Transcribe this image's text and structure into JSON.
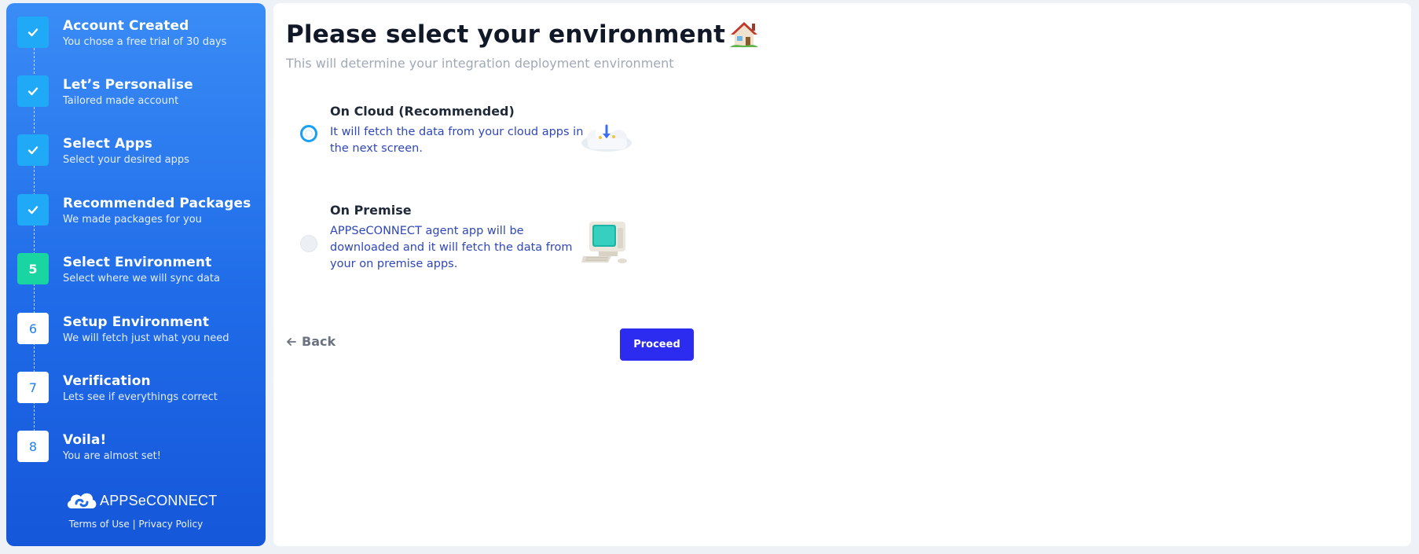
{
  "sidebar": {
    "steps": [
      {
        "badge": "",
        "title": "Account Created",
        "subtitle": "You chose a free trial of 30 days",
        "status": "done"
      },
      {
        "badge": "",
        "title": "Let’s Personalise",
        "subtitle": "Tailored made account",
        "status": "done"
      },
      {
        "badge": "",
        "title": "Select Apps",
        "subtitle": "Select your desired apps",
        "status": "done"
      },
      {
        "badge": "",
        "title": "Recommended Packages",
        "subtitle": "We made packages for you",
        "status": "done"
      },
      {
        "badge": "5",
        "title": "Select Environment",
        "subtitle": "Select where we will sync data",
        "status": "active"
      },
      {
        "badge": "6",
        "title": "Setup Environment",
        "subtitle": "We will fetch just what you need",
        "status": "pending"
      },
      {
        "badge": "7",
        "title": "Verification",
        "subtitle": "Lets see if everythings correct",
        "status": "pending"
      },
      {
        "badge": "8",
        "title": "Voila!",
        "subtitle": "You are almost set!",
        "status": "pending"
      }
    ],
    "brand": "APPSeCONNECT",
    "terms": "Terms of Use",
    "separator": " | ",
    "privacy": "Privacy Policy"
  },
  "main": {
    "title": "Please select your environment",
    "subtitle": "This will determine your integration deployment environment",
    "options": [
      {
        "title": "On Cloud (Recommended)",
        "description": "It will fetch the data from your cloud apps in the next screen.",
        "selected": true,
        "icon": "cloud-download-icon"
      },
      {
        "title": "On Premise",
        "description": "APPSeCONNECT agent app will be downloaded and it will fetch the data from your on premise apps.",
        "selected": false,
        "icon": "desktop-computer-icon"
      }
    ],
    "back_label": "Back",
    "proceed_label": "Proceed"
  },
  "colors": {
    "sidebar_top": "#3a8cf6",
    "sidebar_bottom": "#1557d9",
    "done_badge": "#20a9f7",
    "active_badge": "#19d5a2",
    "proceed_button": "#2c2cf0",
    "option_text": "#2f47b8"
  }
}
